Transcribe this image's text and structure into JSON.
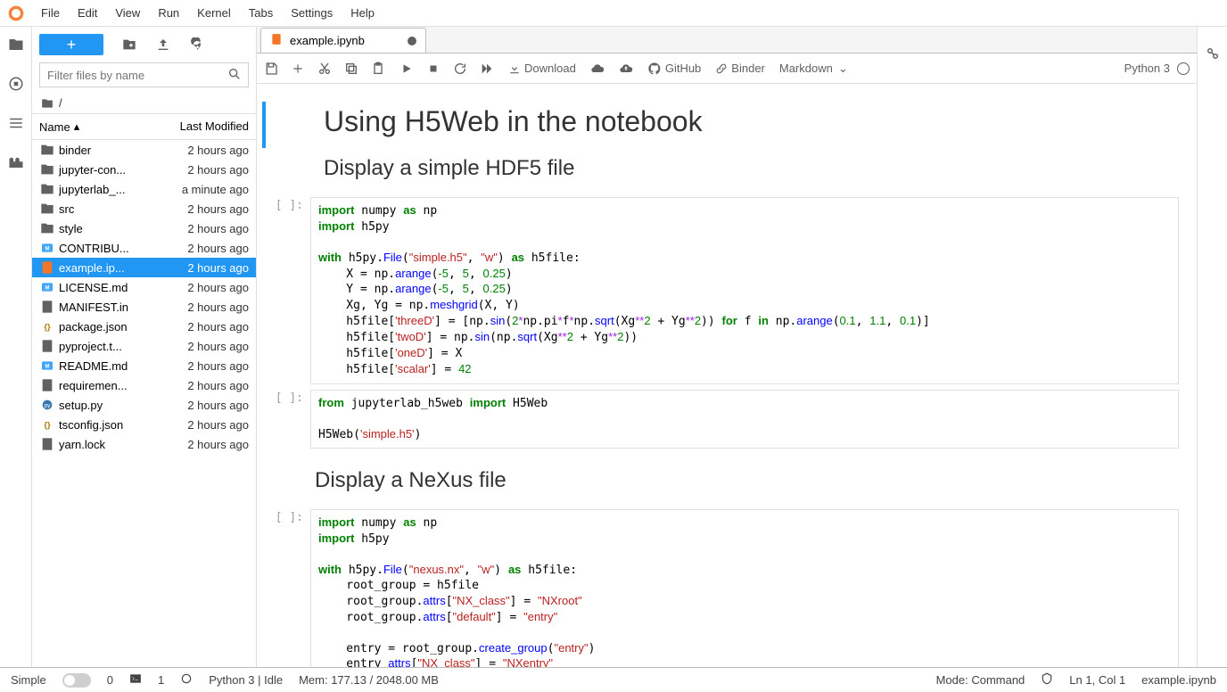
{
  "menus": [
    "File",
    "Edit",
    "View",
    "Run",
    "Kernel",
    "Tabs",
    "Settings",
    "Help"
  ],
  "filebrowser": {
    "filter_placeholder": "Filter files by name",
    "crumb": "/",
    "columns": {
      "name": "Name",
      "modified": "Last Modified"
    },
    "items": [
      {
        "icon": "folder",
        "name": "binder",
        "modified": "2 hours ago",
        "selected": false
      },
      {
        "icon": "folder",
        "name": "jupyter-con...",
        "modified": "2 hours ago",
        "selected": false
      },
      {
        "icon": "folder",
        "name": "jupyterlab_...",
        "modified": "a minute ago",
        "selected": false
      },
      {
        "icon": "folder",
        "name": "src",
        "modified": "2 hours ago",
        "selected": false
      },
      {
        "icon": "folder",
        "name": "style",
        "modified": "2 hours ago",
        "selected": false
      },
      {
        "icon": "md",
        "name": "CONTRIBU...",
        "modified": "2 hours ago",
        "selected": false
      },
      {
        "icon": "nb",
        "name": "example.ip...",
        "modified": "2 hours ago",
        "selected": true
      },
      {
        "icon": "md",
        "name": "LICENSE.md",
        "modified": "2 hours ago",
        "selected": false
      },
      {
        "icon": "text",
        "name": "MANIFEST.in",
        "modified": "2 hours ago",
        "selected": false
      },
      {
        "icon": "json",
        "name": "package.json",
        "modified": "2 hours ago",
        "selected": false
      },
      {
        "icon": "text",
        "name": "pyproject.t...",
        "modified": "2 hours ago",
        "selected": false
      },
      {
        "icon": "md",
        "name": "README.md",
        "modified": "2 hours ago",
        "selected": false
      },
      {
        "icon": "text",
        "name": "requiremen...",
        "modified": "2 hours ago",
        "selected": false
      },
      {
        "icon": "py",
        "name": "setup.py",
        "modified": "2 hours ago",
        "selected": false
      },
      {
        "icon": "json",
        "name": "tsconfig.json",
        "modified": "2 hours ago",
        "selected": false
      },
      {
        "icon": "text",
        "name": "yarn.lock",
        "modified": "2 hours ago",
        "selected": false
      }
    ]
  },
  "tab": {
    "title": "example.ipynb"
  },
  "toolbar": {
    "download": "Download",
    "github": "GitHub",
    "binder": "Binder",
    "celltype": "Markdown",
    "kernel": "Python 3"
  },
  "notebook": {
    "h1": "Using H5Web in the notebook",
    "h2a": "Display a simple HDF5 file",
    "h2b": "Display a NeXus file"
  },
  "statusbar": {
    "simple": "Simple",
    "zero": "0",
    "one": "1",
    "kernel": "Python 3 | Idle",
    "mem": "Mem: 177.13 / 2048.00 MB",
    "mode": "Mode: Command",
    "pos": "Ln 1, Col 1",
    "file": "example.ipynb"
  }
}
